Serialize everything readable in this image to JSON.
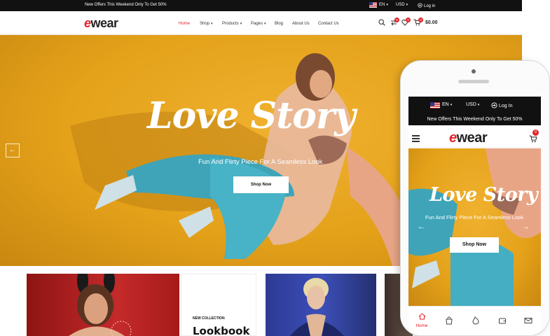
{
  "desktop": {
    "topbar": {
      "offer": "New Offers This Weekend Only To Get 50%",
      "language": "EN",
      "currency": "USD",
      "login": "Log in"
    },
    "header": {
      "logo_e": "e",
      "logo_rest": "wear",
      "nav": [
        "Home",
        "Shop",
        "Products",
        "Pages",
        "Blog",
        "About Us",
        "Contact Us"
      ],
      "compare_count": "0",
      "wishlist_count": "0",
      "cart_count": "0",
      "cart_total": "$0.00"
    },
    "hero": {
      "title": "Love Story",
      "subtitle": "Fun And Flirty Piece For A Seamless Look",
      "button": "Shop Now"
    },
    "banners": {
      "collection_label": "NEW COLLECTION",
      "collection_title": "Lookbook"
    }
  },
  "mobile": {
    "language": "EN",
    "currency": "USD",
    "login": "Log In",
    "offer": "New Offers This Weekend Only To Get 50%",
    "logo_e": "e",
    "logo_rest": "wear",
    "cart_count": "0",
    "hero": {
      "title": "Love Story",
      "subtitle": "Fun And Flirty Piece For A Seamless Look",
      "button": "Shop Now"
    },
    "tabbar": {
      "home_label": "Home"
    }
  },
  "colors": {
    "accent": "#e3242b",
    "hero_bg": "#e4a21a",
    "topbar": "#111111"
  }
}
